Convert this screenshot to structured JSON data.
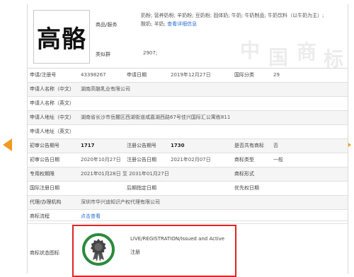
{
  "nav": {
    "prev_icon": "arrow-left-icon",
    "next_icon": "arrow-right-icon",
    "arrow_color": "#f29a1f"
  },
  "header": {
    "logo_text": "高骼",
    "goods_label": "商品/服务",
    "goods_line1": "奶粉; 营养奶粉; 羊奶粉; 豆奶粉; 固体奶; 牛奶; 牛奶制品; 牛奶饮料（以牛奶为主）;",
    "goods_line2_prefix": "酸奶; 羊奶; ",
    "goods_more_link": "查看详细信息",
    "class_group_label": "类似群",
    "class_group_value": "2907;",
    "watermark": "中国商标"
  },
  "rows": {
    "reg_no_label": "申请/注册号",
    "reg_no": "43398267",
    "app_date_label": "申请日期",
    "app_date": "2019年12月27日",
    "intl_class_label": "国际分类",
    "intl_class": "29",
    "applicant_cn_label": "申请人名称（中文）",
    "applicant_cn": "湖南高骼乳业有限公司",
    "applicant_en_label": "申请人名称（英文）",
    "applicant_en": "",
    "addr_cn_label": "申请人地址（中文）",
    "addr_cn": "湖南省长沙市岳麓区西湖街道咸嘉湖西路67号佳兴国际汇公寓栋811",
    "addr_en_label": "申请人地址（英文）",
    "addr_en": "",
    "pre_pub_no_label": "初审公告期号",
    "pre_pub_no": "1717",
    "reg_pub_no_label": "注册公告期号",
    "reg_pub_no": "1730",
    "shared_label": "是否共有商标",
    "shared": "否",
    "pre_pub_date_label": "初审公告日期",
    "pre_pub_date": "2020年10月27日",
    "reg_pub_date_label": "注册公告日期",
    "reg_pub_date": "2021年02月07日",
    "mark_type_label": "商标类型",
    "mark_type": "一般",
    "exclusive_label": "专用权期限",
    "exclusive": "2021年01月28日 至 2031年01月27日",
    "mark_form_label": "商标形式",
    "mark_form": "",
    "intl_reg_date_label": "国际注册日期",
    "intl_reg_date": "",
    "later_date_label": "后期指定日期",
    "later_date": "",
    "priority_date_label": "优先权日期",
    "priority_date": "",
    "agency_label": "代理/办理机构",
    "agency": "深圳市华兴迪知识产权代理有限公司",
    "process_label": "商标流程",
    "process_link": "点击查看"
  },
  "status": {
    "label": "商标状态图标",
    "en": "LIVE/REGISTRATION/Issued and Active",
    "cn": "注册",
    "badge_icon": "award-seal-icon",
    "badge_ring_color": "#2a8a3c",
    "border_color": "#e02424"
  }
}
